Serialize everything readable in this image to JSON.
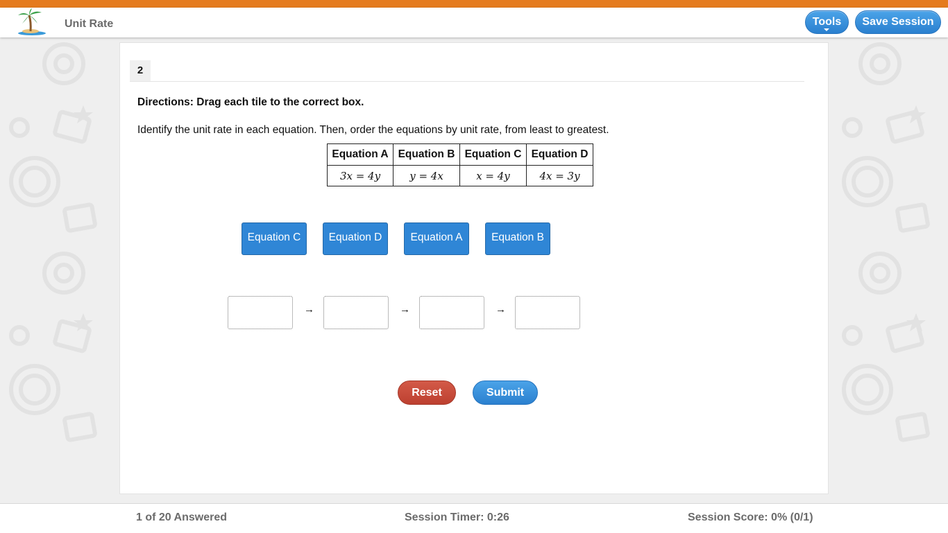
{
  "header": {
    "app_title": "Unit Rate",
    "tools_label": "Tools",
    "save_label": "Save Session"
  },
  "question": {
    "number": "2",
    "directions": "Directions: Drag each tile to the correct box.",
    "prompt": "Identify the unit rate in each equation. Then, order the equations by unit rate, from least to greatest.",
    "table": {
      "headers": [
        "Equation A",
        "Equation B",
        "Equation C",
        "Equation D"
      ],
      "cells": [
        "3x = 4y",
        "y = 4x",
        "x = 4y",
        "4x = 3y"
      ]
    },
    "tiles": [
      "Equation C",
      "Equation D",
      "Equation A",
      "Equation B"
    ],
    "arrow": "→",
    "reset_label": "Reset",
    "submit_label": "Submit"
  },
  "footer": {
    "answered": "1 of 20 Answered",
    "timer": "Session Timer: 0:26",
    "score": "Session Score: 0% (0/1)"
  },
  "colors": {
    "top_bar": "#e57b1e",
    "primary_button": "#2f86d6",
    "reset_button": "#c8493a"
  }
}
